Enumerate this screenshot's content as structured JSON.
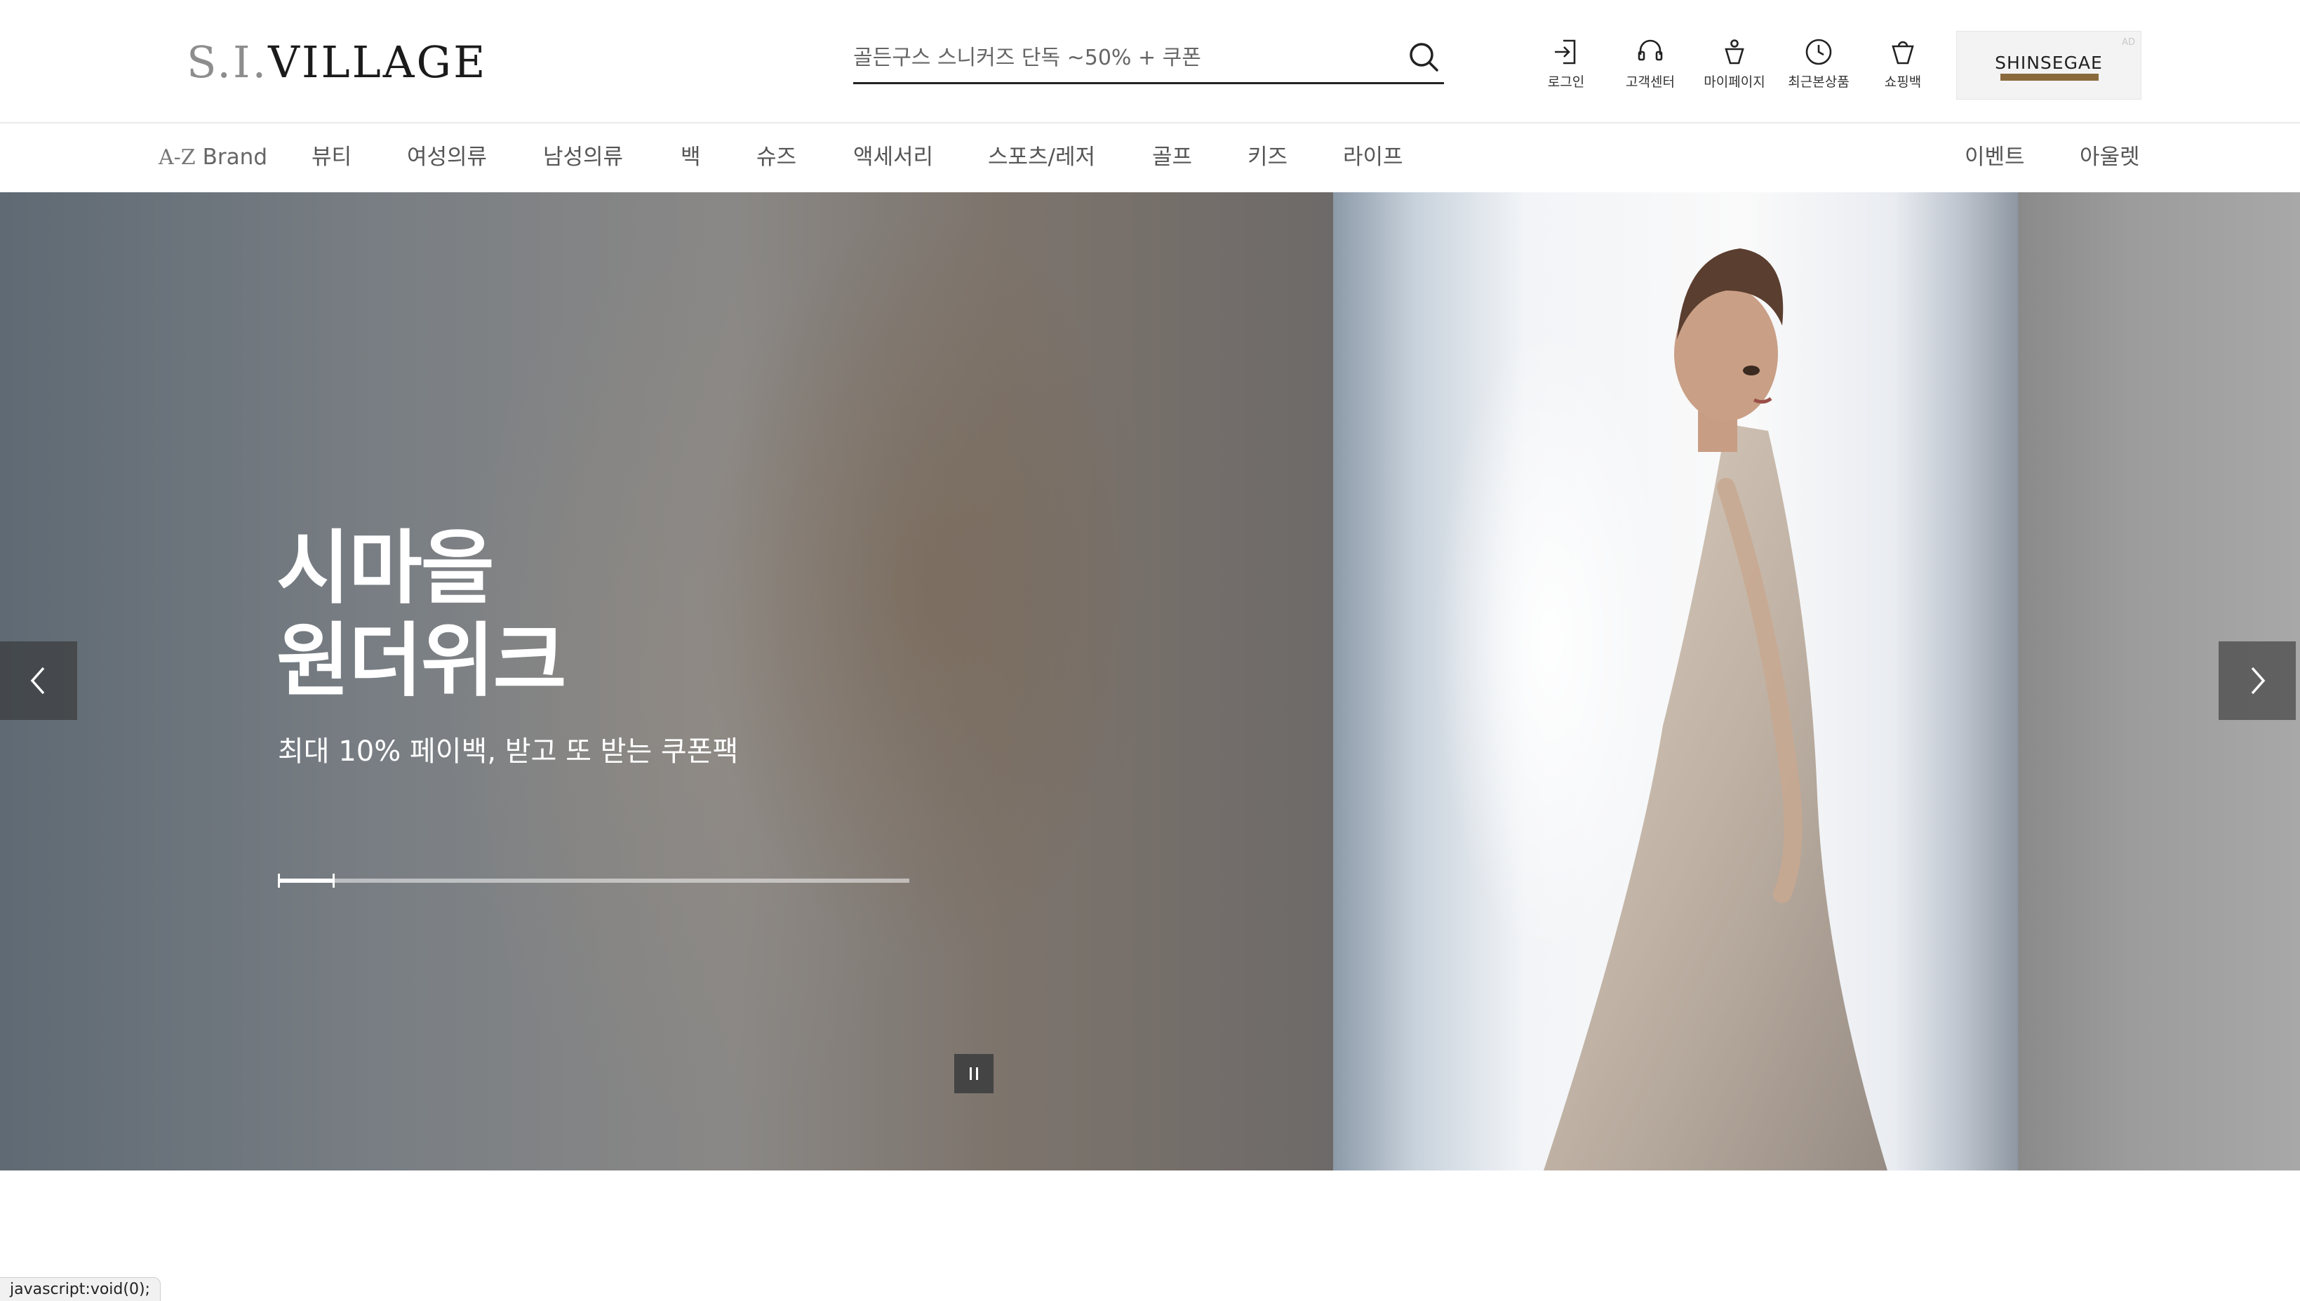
{
  "header": {
    "logo_pre": "S.I.",
    "logo_post": "VILLAGE",
    "search_placeholder": "골든구스 스니커즈 단독 ~50% + 쿠폰",
    "utility_links": [
      {
        "label": "로그인",
        "icon": "login-icon"
      },
      {
        "label": "고객센터",
        "icon": "headset-icon"
      },
      {
        "label": "마이페이지",
        "icon": "mypage-icon"
      },
      {
        "label": "최근본상품",
        "icon": "clock-icon"
      },
      {
        "label": "쇼핑백",
        "icon": "shopping-bag-icon"
      }
    ],
    "ad": {
      "label": "AD",
      "name": "SHINSEGAE"
    }
  },
  "nav": {
    "brand_icon": "A-Z",
    "brand_label": "Brand",
    "categories": [
      "뷰티",
      "여성의류",
      "남성의류",
      "백",
      "슈즈",
      "액세서리",
      "스포츠/레저",
      "골프",
      "키즈",
      "라이프"
    ],
    "right_links": [
      "이벤트",
      "아울렛"
    ]
  },
  "hero": {
    "title_line1": "시마을",
    "title_line2": "원더위크",
    "subtitle": "최대 10% 페이백, 받고 또 받는 쿠폰팩",
    "progress": 0.09,
    "pause_icon": "pause-icon",
    "prev_icon": "chevron-left-icon",
    "next_icon": "chevron-right-icon"
  },
  "status_bar": "javascript:void(0);",
  "colors": {
    "text_dark": "#111111",
    "nav_text": "#555555",
    "search_underline": "#222222",
    "ad_bar": "#8a6a3d"
  }
}
